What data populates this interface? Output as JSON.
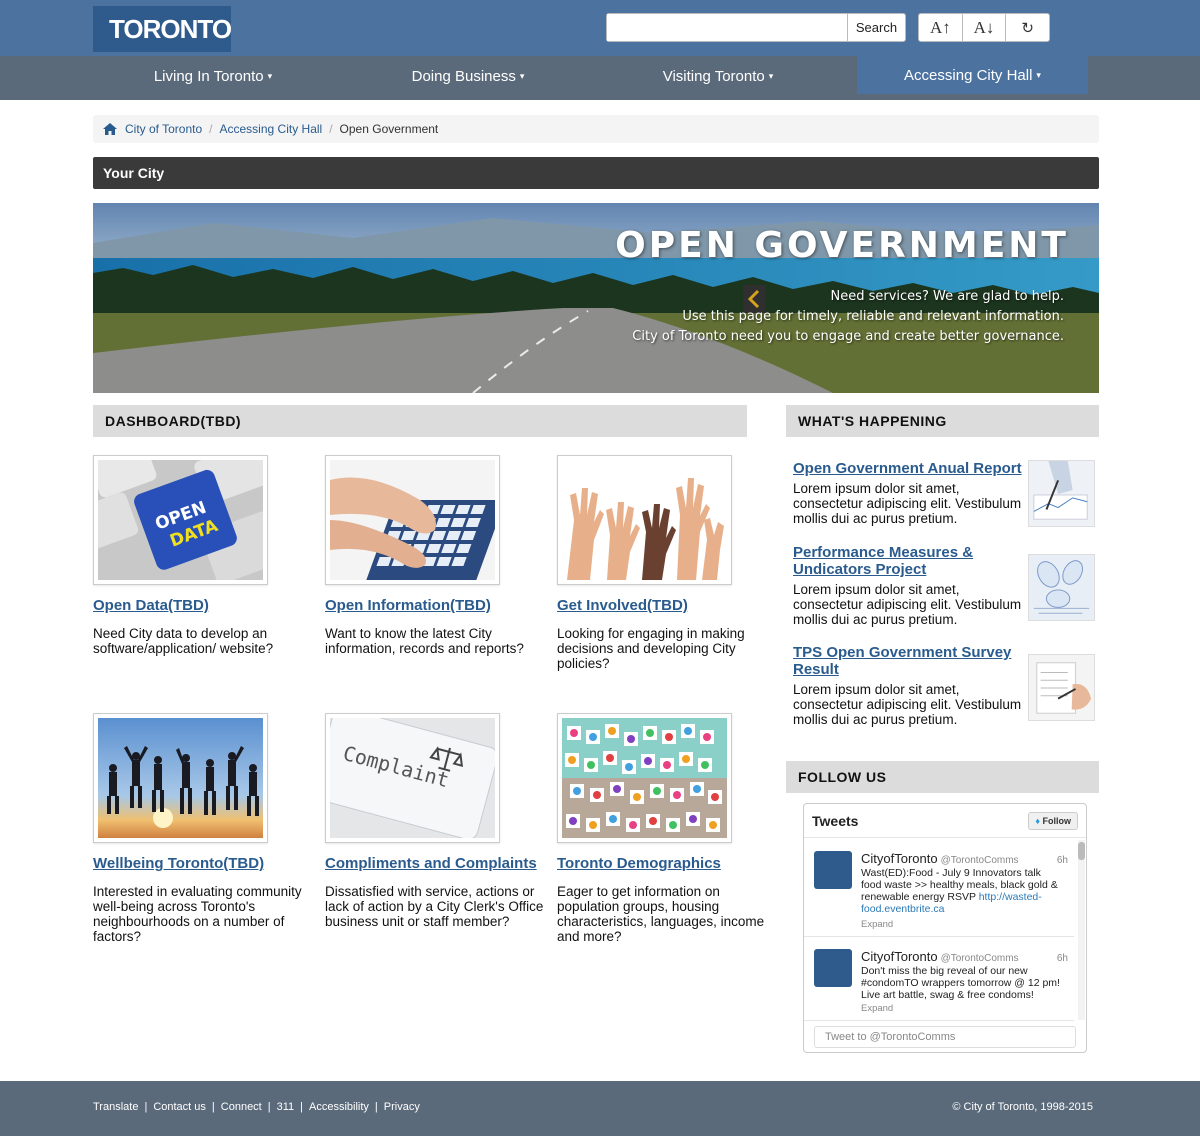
{
  "header": {
    "logo_text": "TORONTO",
    "search_placeholder": "",
    "search_button": "Search",
    "font_increase": "A↑",
    "font_decrease": "A↓",
    "reset": "↻"
  },
  "nav": {
    "items": [
      {
        "label": "Living In Toronto"
      },
      {
        "label": "Doing Business"
      },
      {
        "label": "Visiting Toronto"
      },
      {
        "label": "Accessing City Hall"
      }
    ],
    "caret": "▾"
  },
  "breadcrumb": {
    "items": [
      "City of Toronto",
      "Accessing City Hall",
      "Open Government"
    ],
    "separator": "/"
  },
  "your_city": "Your City",
  "hero": {
    "title": "OPEN GOVERNMENT",
    "lines": [
      "Need services? We are glad to help.",
      "Use this page for timely, reliable and relevant information.",
      "City of Toronto need you to engage and create better governance."
    ]
  },
  "dashboard": {
    "heading": "DASHBOARD(TBD)",
    "cards": [
      {
        "title": "Open Data(TBD)",
        "desc": "Need City data to develop an software/application/ website?",
        "image_label": "OPEN DATA"
      },
      {
        "title": "Open Information(TBD)",
        "desc": "Want to know the latest City information, records and reports?"
      },
      {
        "title": "Get Involved(TBD)",
        "desc": "Looking for engaging in making decisions and developing City policies?"
      },
      {
        "title": "Wellbeing Toronto(TBD)",
        "desc": "Interested in evaluating community well-being across Toronto's neighbourhoods on a number of factors?"
      },
      {
        "title": "Compliments and Complaints",
        "desc": "Dissatisfied with service, actions or lack of action by a City Clerk's Office business unit or staff member?",
        "image_label": "Complaint"
      },
      {
        "title": "Toronto Demographics",
        "desc": "Eager to get information on population groups, housing characteristics, languages, income and more?"
      }
    ]
  },
  "whats_happening": {
    "heading": "WHAT'S HAPPENING",
    "items": [
      {
        "title": "Open Government Anual Report",
        "desc": "Lorem ipsum dolor sit amet, consectetur adipiscing elit. Vestibulum mollis dui ac purus pretium."
      },
      {
        "title": "Performance Measures & Undicators Project",
        "desc": "Lorem ipsum dolor sit amet, consectetur adipiscing elit. Vestibulum mollis dui ac purus pretium."
      },
      {
        "title": "TPS Open Government Survey Result",
        "desc": "Lorem ipsum dolor sit amet, consectetur adipiscing elit. Vestibulum mollis dui ac purus pretium."
      }
    ]
  },
  "follow_us": {
    "heading": "FOLLOW US",
    "widget_title": "Tweets",
    "follow_button": "Follow",
    "tweets": [
      {
        "name": "CityofToronto",
        "handle": "@TorontoComms",
        "time": "6h",
        "text": "Wast(ED):Food - July 9 Innovators talk food waste >> healthy meals, black gold & renewable energy RSVP ",
        "link": "http://wasted-food.eventbrite.ca",
        "expand": "Expand"
      },
      {
        "name": "CityofToronto",
        "handle": "@TorontoComms",
        "time": "6h",
        "text": "Don't miss the big reveal of our new #condomTO wrappers tomorrow @ 12 pm! Live art battle, swag & free condoms!",
        "link": "",
        "expand": "Expand"
      }
    ],
    "tweet_input": "Tweet to @TorontoComms"
  },
  "footer": {
    "links": [
      "Translate",
      "Contact us",
      "Connect",
      "311",
      "Accessibility",
      "Privacy"
    ],
    "separator": "|",
    "copyright": "© City of Toronto, 1998-2015"
  },
  "colors": {
    "header_blue": "#4c72a0",
    "nav_gray": "#5b6a7a",
    "link_blue": "#2a5b8e"
  }
}
